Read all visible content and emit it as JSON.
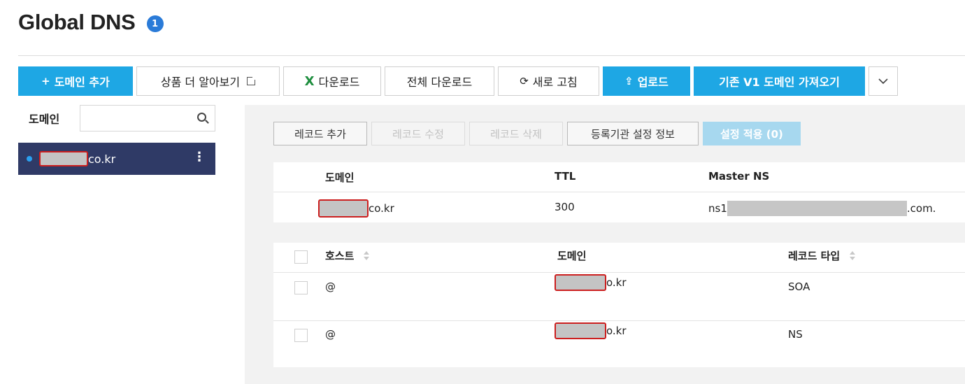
{
  "header": {
    "title": "Global DNS",
    "info_badge": "1"
  },
  "toolbar": {
    "add_domain": "도메인 추가",
    "learn_more": "상품 더 알아보기",
    "download": "다운로드",
    "download_all": "전체 다운로드",
    "refresh": "새로 고침",
    "upload": "업로드",
    "import_v1": "기존 V1 도메인 가져오기"
  },
  "sidebar": {
    "label": "도메인",
    "search_placeholder": "",
    "selected_domain_suffix": "co.kr"
  },
  "record_toolbar": {
    "add": "레코드 추가",
    "edit": "레코드 수정",
    "delete": "레코드 삭제",
    "registrar": "등록기관 설정 정보",
    "apply": "설정 적용 (0)"
  },
  "domain_table": {
    "headers": {
      "domain": "도메인",
      "ttl": "TTL",
      "master_ns": "Master NS"
    },
    "row": {
      "domain_suffix": "co.kr",
      "ttl": "300",
      "ns_prefix": "ns1",
      "ns_suffix": ".com."
    }
  },
  "record_table": {
    "headers": {
      "host": "호스트",
      "domain": "도메인",
      "type": "레코드 타입"
    },
    "rows": [
      {
        "host": "@",
        "domain_suffix": "o.kr",
        "type": "SOA"
      },
      {
        "host": "@",
        "domain_suffix": "o.kr",
        "type": "NS"
      }
    ]
  },
  "colors": {
    "primary": "#1ea7e4",
    "sidebar_selected": "#2f3a66",
    "badge": "#2a7bd8",
    "redaction_border": "#cc1f1f"
  }
}
